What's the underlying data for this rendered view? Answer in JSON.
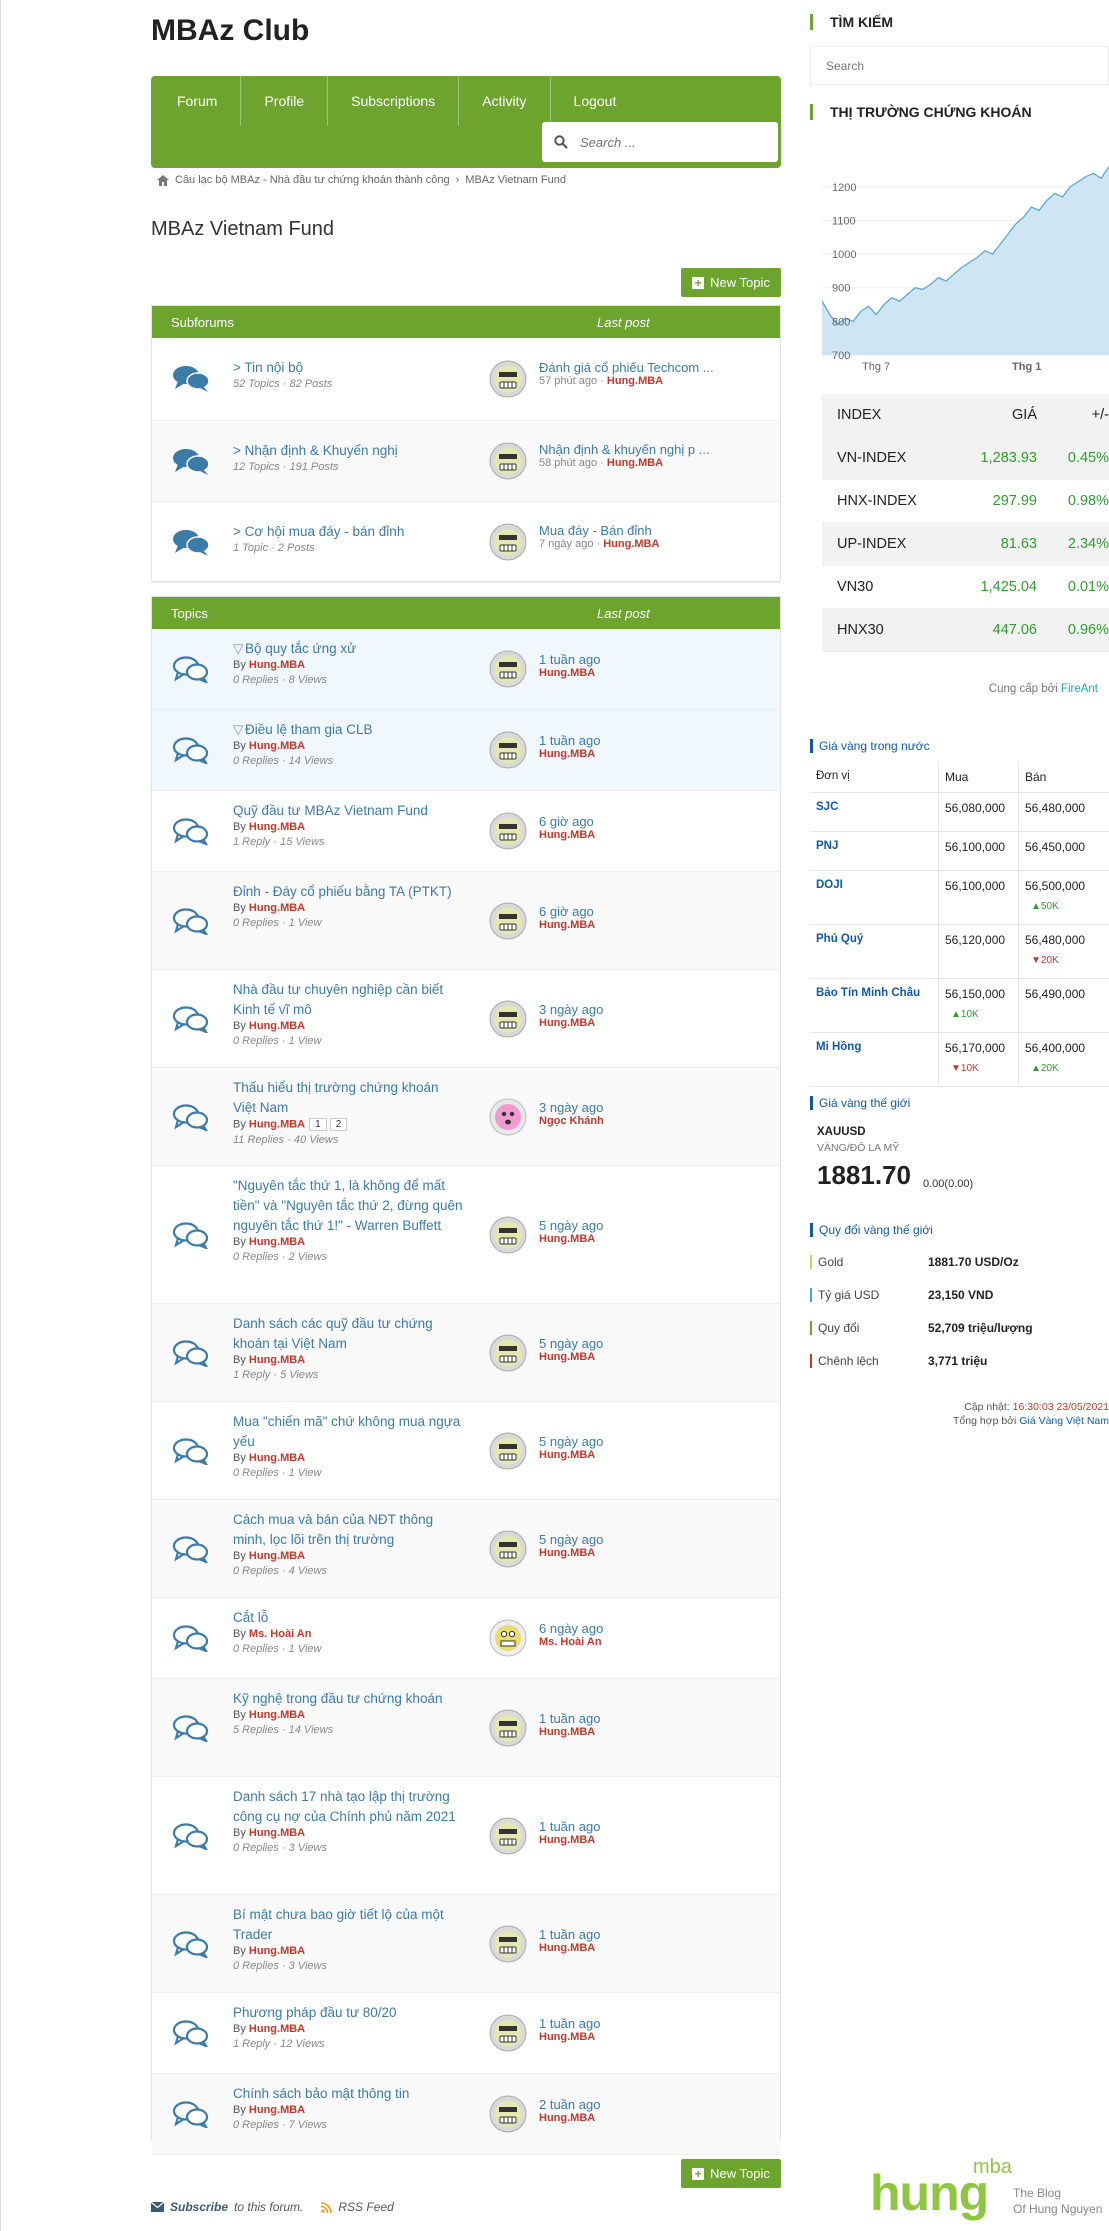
{
  "site_title": "MBAz Club",
  "nav": {
    "forum": "Forum",
    "profile": "Profile",
    "subscriptions": "Subscriptions",
    "activity": "Activity",
    "logout": "Logout"
  },
  "search": {
    "placeholder": "Search ..."
  },
  "breadcrumb": {
    "home": "Câu lạc bộ MBAz - Nhà đầu tư chứng khoán thành công",
    "current": "MBAz Vietnam Fund"
  },
  "page_title": "MBAz Vietnam Fund",
  "new_topic_label": "New Topic",
  "subforums_panel": {
    "header": "Subforums",
    "last_post": "Last post"
  },
  "subforums": [
    {
      "title": "> Tin nội bộ",
      "meta": "52 Topics · 82 Posts",
      "last_title": "Đánh giá cổ phiếu Techcom ...",
      "last_time": "57 phút ago",
      "last_user": "Hung.MBA"
    },
    {
      "title": "> Nhận định & Khuyến nghị",
      "meta": "12 Topics · 191 Posts",
      "last_title": "Nhận định & khuyến nghị p ...",
      "last_time": "58 phút ago",
      "last_user": "Hung.MBA"
    },
    {
      "title": "> Cơ hội mua đáy - bán đỉnh",
      "meta": "1 Topic · 2 Posts",
      "last_title": "Mua đáy - Bán đỉnh",
      "last_time": "7 ngày ago",
      "last_user": "Hung.MBA"
    }
  ],
  "topics_panel": {
    "header": "Topics",
    "last_post": "Last post"
  },
  "by_label": "By",
  "topics": [
    {
      "title": "Bộ quy tắc ứng xử",
      "user": "Hung.MBA",
      "stats": "0 Replies · 8 Views",
      "last": "1 tuần ago",
      "last_user": "Hung.MBA"
    },
    {
      "title": "Điều lệ tham gia CLB",
      "user": "Hung.MBA",
      "stats": "0 Replies · 14 Views",
      "last": "1 tuần ago",
      "last_user": "Hung.MBA"
    },
    {
      "title": "Quỹ đầu tư MBAz Vietnam Fund",
      "user": "Hung.MBA",
      "stats": "1 Reply · 15 Views",
      "last": "6 giờ ago",
      "last_user": "Hung.MBA"
    },
    {
      "title": "Đỉnh - Đáy cổ phiếu bằng TA (PTKT)",
      "user": "Hung.MBA",
      "stats": "0 Replies · 1 View",
      "last": "6 giờ ago",
      "last_user": "Hung.MBA"
    },
    {
      "title": "Nhà đầu tư chuyên nghiệp cần biết Kinh tế vĩ mô",
      "user": "Hung.MBA",
      "stats": "0 Replies · 1 View",
      "last": "3 ngày ago",
      "last_user": "Hung.MBA"
    },
    {
      "title": "Thấu hiểu thị trường chứng khoán Việt Nam",
      "user": "Hung.MBA",
      "stats": "11 Replies · 40 Views",
      "last": "3 ngày ago",
      "last_user": "Ngọc Khánh",
      "pages": [
        "1",
        "2"
      ]
    },
    {
      "title": "\"Nguyên tắc thứ 1, là không để mất tiền\" và \"Nguyên tắc thứ 2, đừng quên nguyên tắc thứ 1!\" - Warren Buffett",
      "user": "Hung.MBA",
      "stats": "0 Replies · 2 Views",
      "last": "5 ngày ago",
      "last_user": "Hung.MBA"
    },
    {
      "title": "Danh sách các quỹ đầu tư chứng khoán tại Việt Nam",
      "user": "Hung.MBA",
      "stats": "1 Reply · 5 Views",
      "last": "5 ngày ago",
      "last_user": "Hung.MBA"
    },
    {
      "title": "Mua \"chiến mã\" chứ không mua ngựa yếu",
      "user": "Hung.MBA",
      "stats": "0 Replies · 1 View",
      "last": "5 ngày ago",
      "last_user": "Hung.MBA"
    },
    {
      "title": "Cách mua và bán của NĐT thông minh, lọc lõi trên thị trường",
      "user": "Hung.MBA",
      "stats": "0 Replies · 4 Views",
      "last": "5 ngày ago",
      "last_user": "Hung.MBA"
    },
    {
      "title": "Cắt lỗ",
      "user": "Ms. Hoài An",
      "stats": "0 Replies · 1 View",
      "last": "6 ngày ago",
      "last_user": "Ms. Hoài An"
    },
    {
      "title": "Kỹ nghệ trong đầu tư chứng khoán",
      "user": "Hung.MBA",
      "stats": "5 Replies · 14 Views",
      "last": "1 tuần ago",
      "last_user": "Hung.MBA"
    },
    {
      "title": "Danh sách 17 nhà tạo lập thị trường công cụ nợ của Chính phủ năm 2021",
      "user": "Hung.MBA",
      "stats": "0 Replies · 3 Views",
      "last": "1 tuần ago",
      "last_user": "Hung.MBA"
    },
    {
      "title": "Bí mật chưa bao giờ tiết lộ của một Trader",
      "user": "Hung.MBA",
      "stats": "0 Replies · 3 Views",
      "last": "1 tuần ago",
      "last_user": "Hung.MBA"
    },
    {
      "title": "Phương pháp đầu tư 80/20",
      "user": "Hung.MBA",
      "stats": "1 Reply · 12 Views",
      "last": "1 tuần ago",
      "last_user": "Hung.MBA"
    },
    {
      "title": "Chính sách bảo mật thông tin",
      "user": "Hung.MBA",
      "stats": "0 Replies · 7 Views",
      "last": "2 tuần ago",
      "last_user": "Hung.MBA"
    }
  ],
  "footer": {
    "subscribe": "Subscribe",
    "subscribe_rest": "to this forum.",
    "rss": "RSS Feed"
  },
  "sidebar": {
    "search_title": "TÌM KIẾM",
    "search_placeholder": "Search",
    "market_title": "THỊ TRƯỜNG CHỨNG KHOÁN",
    "chart_ticks_y": [
      "1200",
      "1100",
      "1000",
      "900",
      "800",
      "700"
    ],
    "chart_ticks_x": [
      "Thg 7",
      "Thg 1"
    ],
    "stock_head": {
      "c1": "INDEX",
      "c2": "GIÁ",
      "c3": "+/-"
    },
    "stocks": [
      {
        "name": "VN-INDEX",
        "price": "1,283.93",
        "chg": "0.45%"
      },
      {
        "name": "HNX-INDEX",
        "price": "297.99",
        "chg": "0.98%"
      },
      {
        "name": "UP-INDEX",
        "price": "81.63",
        "chg": "2.34%"
      },
      {
        "name": "VN30",
        "price": "1,425.04",
        "chg": "0.01%"
      },
      {
        "name": "HNX30",
        "price": "447.06",
        "chg": "0.96%"
      }
    ],
    "provider_label": "Cung cấp bởi",
    "provider": "FireAnt",
    "gold_domestic_title": "Giá vàng trong nước",
    "gold_head": {
      "a": "Đơn vị",
      "b": "Mua",
      "c": "Bán"
    },
    "gold": [
      {
        "name": "SJC",
        "buy": "56,080,000",
        "sell": "56,480,000"
      },
      {
        "name": "PNJ",
        "buy": "56,100,000",
        "sell": "56,450,000"
      },
      {
        "name": "DOJI",
        "buy": "56,100,000",
        "sell": "56,500,000",
        "sell_chg": "▲50K",
        "sell_dir": "up"
      },
      {
        "name": "Phú Quý",
        "buy": "56,120,000",
        "sell": "56,480,000",
        "sell_chg": "▼20K",
        "sell_dir": "dn"
      },
      {
        "name": "Bảo Tín Minh Châu",
        "buy": "56,150,000",
        "buy_chg": "▲10K",
        "buy_dir": "up",
        "sell": "56,490,000"
      },
      {
        "name": "Mi Hồng",
        "buy": "56,170,000",
        "buy_chg": "▼10K",
        "buy_dir": "dn",
        "sell": "56,400,000",
        "sell_chg": "▲20K",
        "sell_dir": "up"
      }
    ],
    "gold_world_title": "Giá vàng thế giới",
    "xau_symbol": "XAUUSD",
    "xau_desc": "VÀNG/ĐÔ LA MỸ",
    "xau_price": "1881.70",
    "xau_change": "0.00(0.00)",
    "conv_title": "Quy đổi vàng thế giới",
    "conv": [
      {
        "k": "Gold",
        "v": "1881.70 USD/Oz",
        "c": "#c8d45a"
      },
      {
        "k": "Tỷ giá USD",
        "v": "23,150 VND",
        "c": "#4aa3d6"
      },
      {
        "k": "Quy đổi",
        "v": "52,709 triệu/lượng",
        "c": "#6da42e"
      },
      {
        "k": "Chênh lệch",
        "v": "3,771 triệu",
        "c": "#c0392b"
      }
    ],
    "updated_label": "Cập nhật:",
    "updated_time": "16:30:03 23/05/2021",
    "aggregated_label": "Tổng hợp bởi",
    "aggregated_by": "Giá Vàng Việt Nam",
    "logo_main": "hung",
    "logo_sup": "mba",
    "logo_tag1": "The Blog",
    "logo_tag2": "Of Hung Nguyen"
  }
}
